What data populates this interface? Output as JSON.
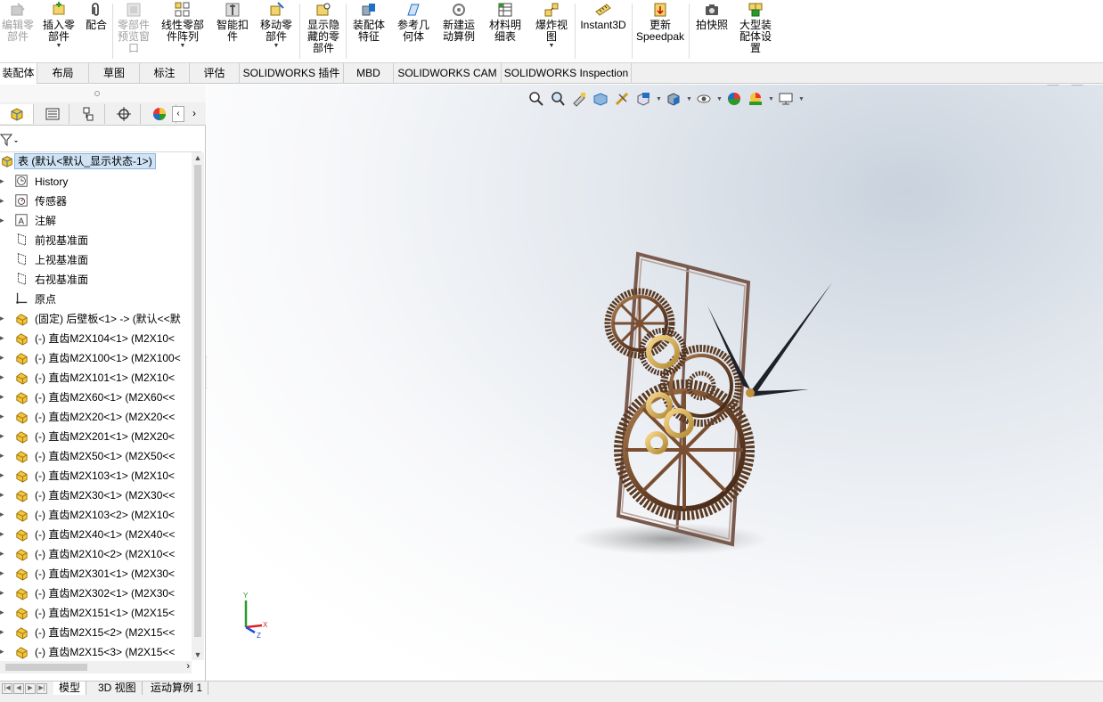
{
  "ribbon": {
    "buttons": [
      {
        "label": "编辑零\n部件",
        "disabled": true
      },
      {
        "label": "插入零\n部件",
        "disabled": false
      },
      {
        "label": "配合",
        "disabled": false
      },
      {
        "label": "零部件\n预览窗\n口",
        "disabled": true
      },
      {
        "label": "线性零部\n件阵列",
        "disabled": false
      },
      {
        "label": "智能扣\n件",
        "disabled": false
      },
      {
        "label": "移动零\n部件",
        "disabled": false
      },
      {
        "label": "显示隐\n藏的零\n部件",
        "disabled": false
      },
      {
        "label": "装配体\n特征",
        "disabled": false
      },
      {
        "label": "参考几\n何体",
        "disabled": false
      },
      {
        "label": "新建运\n动算例",
        "disabled": false
      },
      {
        "label": "材料明\n细表",
        "disabled": false
      },
      {
        "label": "爆炸视\n图",
        "disabled": false
      },
      {
        "label": "Instant3D",
        "disabled": false
      },
      {
        "label": "更新\nSpeedpak",
        "disabled": false
      },
      {
        "label": "拍快照",
        "disabled": false
      },
      {
        "label": "大型装\n配体设\n置",
        "disabled": false
      }
    ]
  },
  "cm_tabs": [
    "装配体",
    "布局",
    "草图",
    "标注",
    "评估",
    "SOLIDWORKS 插件",
    "MBD",
    "SOLIDWORKS CAM",
    "SOLIDWORKS Inspection"
  ],
  "tree": {
    "root": "表 (默认<默认_显示状态-1>)",
    "items": [
      {
        "label": "History",
        "icon": "history-icon"
      },
      {
        "label": "传感器",
        "icon": "sensor-icon"
      },
      {
        "label": "注解",
        "icon": "annotation-icon"
      },
      {
        "label": "前视基准面",
        "icon": "plane-icon"
      },
      {
        "label": "上视基准面",
        "icon": "plane-icon"
      },
      {
        "label": "右视基准面",
        "icon": "plane-icon"
      },
      {
        "label": "原点",
        "icon": "origin-icon"
      },
      {
        "label": "(固定) 后壁板<1> -> (默认<<默",
        "icon": "part-icon"
      },
      {
        "label": "(-) 直齿M2X104<1> (M2X10<",
        "icon": "part-icon"
      },
      {
        "label": "(-) 直齿M2X100<1> (M2X100<",
        "icon": "part-icon"
      },
      {
        "label": "(-) 直齿M2X101<1> (M2X10<",
        "icon": "part-icon"
      },
      {
        "label": "(-) 直齿M2X60<1> (M2X60<<",
        "icon": "part-icon"
      },
      {
        "label": "(-) 直齿M2X20<1> (M2X20<<",
        "icon": "part-icon"
      },
      {
        "label": "(-) 直齿M2X201<1> (M2X20<",
        "icon": "part-icon"
      },
      {
        "label": "(-) 直齿M2X50<1> (M2X50<<",
        "icon": "part-icon"
      },
      {
        "label": "(-) 直齿M2X103<1> (M2X10<",
        "icon": "part-icon"
      },
      {
        "label": "(-) 直齿M2X30<1> (M2X30<<",
        "icon": "part-icon"
      },
      {
        "label": "(-) 直齿M2X103<2> (M2X10<",
        "icon": "part-icon"
      },
      {
        "label": "(-) 直齿M2X40<1> (M2X40<<",
        "icon": "part-icon"
      },
      {
        "label": "(-) 直齿M2X10<2> (M2X10<<",
        "icon": "part-icon"
      },
      {
        "label": "(-) 直齿M2X301<1> (M2X30<",
        "icon": "part-icon"
      },
      {
        "label": "(-) 直齿M2X302<1> (M2X30<",
        "icon": "part-icon"
      },
      {
        "label": "(-) 直齿M2X151<1> (M2X15<",
        "icon": "part-icon"
      },
      {
        "label": "(-) 直齿M2X15<2> (M2X15<<",
        "icon": "part-icon"
      },
      {
        "label": "(-) 直齿M2X15<3> (M2X15<<",
        "icon": "part-icon"
      }
    ]
  },
  "bottom_tabs": [
    "模型",
    "3D 视图",
    "运动算例 1"
  ],
  "triad": {
    "x": "X",
    "y": "Y",
    "z": "Z"
  },
  "colors": {
    "accent_blue": "#1f6fc5",
    "part_yellow": "#e8b820",
    "gear_bronze": "#8a5a3a",
    "frame_brown": "#6b4a3c"
  }
}
